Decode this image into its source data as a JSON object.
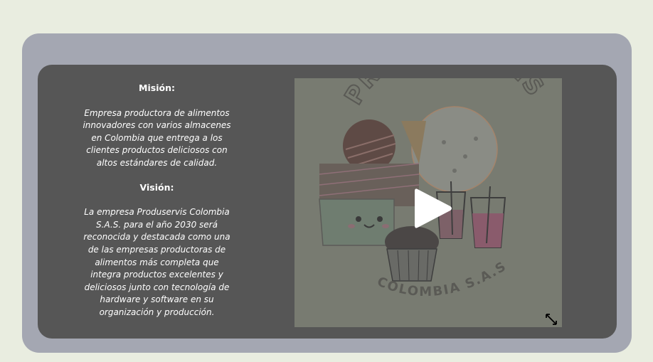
{
  "mision": {
    "heading": "Misión:",
    "text": "Empresa productora de alimentos innovadores con varios almacenes en Colombia que entrega a los clientes productos deliciosos con altos estándares de calidad."
  },
  "vision": {
    "heading": "Visión:",
    "text": "La empresa Produservis Colombia S.A.S. para el año 2030 será reconocida y destacada como una de las empresas productoras de alimentos más completa que integra productos excelentes y deliciosos junto con tecnología de hardware y software en su organización y producción."
  },
  "video": {
    "logo_top_text": "PRODUSERVIS",
    "logo_bottom_text": "COLOMBIA S.A.S",
    "play_icon": "play-icon",
    "expand_icon": "expand-icon"
  },
  "colors": {
    "page_bg": "#e9ede0",
    "outer_panel": "#a4a7b2",
    "inner_panel": "#565656",
    "video_bg": "#787b71",
    "text": "#ffffff"
  }
}
